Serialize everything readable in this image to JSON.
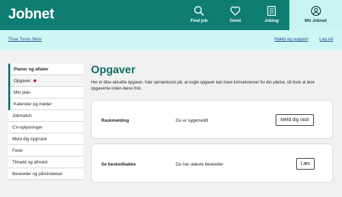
{
  "header": {
    "logo": "Jobnet",
    "nav": [
      {
        "label": "Find job",
        "icon": "search-icon"
      },
      {
        "label": "Gemt",
        "icon": "heart-icon"
      },
      {
        "label": "Joblog",
        "icon": "joblog-icon"
      },
      {
        "label": "Mit Jobnet",
        "icon": "user-icon"
      }
    ]
  },
  "subbar": {
    "user": "Thue Torun Skov",
    "help": "Hjælp og support",
    "logout": "Log ud"
  },
  "sidebar": {
    "group": {
      "heading": "Planer og aftaler",
      "items": [
        "Opgaver",
        "Min plan",
        "Kalender og møder"
      ]
    },
    "items": [
      "Jobmatch",
      "CV-oplysninger",
      "Meld dig syg/rask",
      "Ferie",
      "Tilmeld og afmeld",
      "Beskeder og påmindelser"
    ]
  },
  "main": {
    "title": "Opgaver",
    "intro": "Her er dine aktuelle opgaver. Vær opmærksom på, at nogle opgaver kan have konsekvenser for din ydelse, så husk at løse opgaverne inden deres frist.",
    "tasks": [
      {
        "name": "Raskmelding",
        "desc": "Du er sygemeldt",
        "button": "Meld dig rask"
      },
      {
        "name": "Se beskedbakke",
        "desc": "Du har ulæste beskeder",
        "button": "Læs"
      }
    ]
  },
  "colors": {
    "brand": "#0f7d72",
    "subbar": "#cdf6f5",
    "active_nav": "#c9f4f4",
    "alert_dot": "#d6102c"
  }
}
